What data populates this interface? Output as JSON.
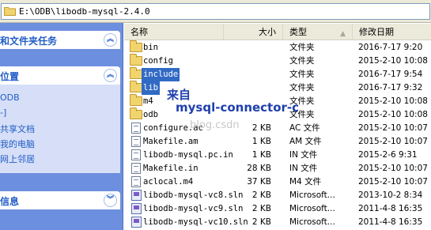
{
  "address_bar": {
    "path": "E:\\ODB\\libodb-mysql-2.4.0"
  },
  "left_pane": {
    "sections": [
      {
        "title": "和文件夹任务",
        "items": []
      },
      {
        "title": "位置",
        "items": [
          "ODB",
          "-]",
          "共享文档",
          "我的电脑",
          "网上邻居"
        ]
      },
      {
        "title": "信息",
        "items": []
      }
    ]
  },
  "columns": {
    "name": "名称",
    "size": "大小",
    "type": "类型",
    "date": "修改日期"
  },
  "files": [
    {
      "name": "bin",
      "size": "",
      "type": "文件夹",
      "date": "2016-7-17 9:20",
      "icon": "folder-icon",
      "selected": false
    },
    {
      "name": "config",
      "size": "",
      "type": "文件夹",
      "date": "2015-2-10 10:08",
      "icon": "folder-icon",
      "selected": false
    },
    {
      "name": "include",
      "size": "",
      "type": "文件夹",
      "date": "2016-7-17 9:54",
      "icon": "folder-icon",
      "selected": true
    },
    {
      "name": "lib",
      "size": "",
      "type": "文件夹",
      "date": "2016-7-17 9:32",
      "icon": "folder-icon",
      "selected": true
    },
    {
      "name": "m4",
      "size": "",
      "type": "文件夹",
      "date": "2015-2-10 10:08",
      "icon": "folder-icon",
      "selected": false
    },
    {
      "name": "odb",
      "size": "",
      "type": "文件夹",
      "date": "2015-2-10 10:08",
      "icon": "folder-icon",
      "selected": false
    },
    {
      "name": "configure.ac",
      "size": "2 KB",
      "type": "AC 文件",
      "date": "2015-2-10 10:07",
      "icon": "file-icon",
      "selected": false
    },
    {
      "name": "Makefile.am",
      "size": "1 KB",
      "type": "AM 文件",
      "date": "2015-2-10 10:07",
      "icon": "file-icon",
      "selected": false
    },
    {
      "name": "libodb-mysql.pc.in",
      "size": "1 KB",
      "type": "IN 文件",
      "date": "2015-2-6 9:31",
      "icon": "file-icon",
      "selected": false
    },
    {
      "name": "Makefile.in",
      "size": "28 KB",
      "type": "IN 文件",
      "date": "2015-2-10 10:07",
      "icon": "file-icon",
      "selected": false
    },
    {
      "name": "aclocal.m4",
      "size": "37 KB",
      "type": "M4 文件",
      "date": "2015-2-10 10:07",
      "icon": "file-icon",
      "selected": false
    },
    {
      "name": "libodb-mysql-vc8.sln",
      "size": "2 KB",
      "type": "Microsoft...",
      "date": "2013-10-2 8:34",
      "icon": "sln-icon",
      "selected": false
    },
    {
      "name": "libodb-mysql-vc9.sln",
      "size": "2 KB",
      "type": "Microsoft...",
      "date": "2011-4-8 16:35",
      "icon": "sln-icon",
      "selected": false
    },
    {
      "name": "libodb-mysql-vc10.sln",
      "size": "2 KB",
      "type": "Microsoft...",
      "date": "2011-4-8 16:35",
      "icon": "sln-icon",
      "selected": false
    }
  ],
  "annotation": {
    "line1": "来自",
    "line2": "mysql-connector-c"
  },
  "watermark": "blog.csdn"
}
